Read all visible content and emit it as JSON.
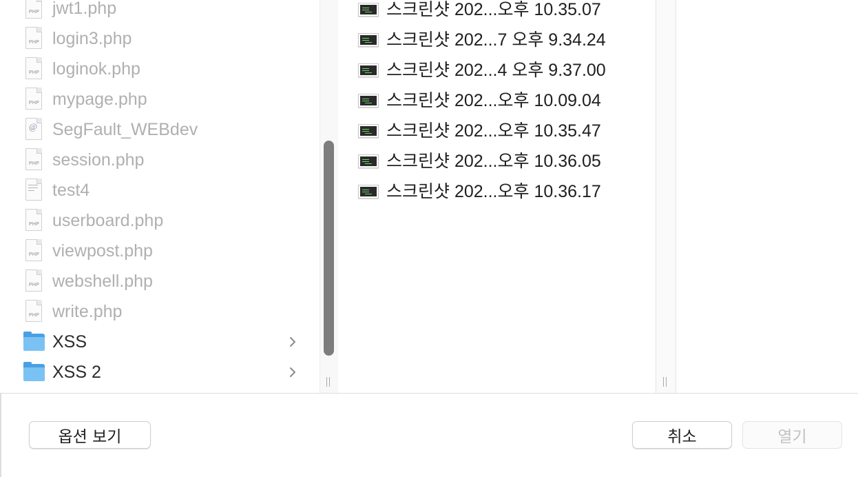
{
  "files_column": [
    {
      "name": "jwt1.php",
      "type": "php",
      "icon": "php-file-icon"
    },
    {
      "name": "login3.php",
      "type": "php",
      "icon": "php-file-icon"
    },
    {
      "name": "loginok.php",
      "type": "php",
      "icon": "php-file-icon"
    },
    {
      "name": "mypage.php",
      "type": "php",
      "icon": "php-file-icon"
    },
    {
      "name": "SegFault_WEBdev",
      "type": "alias",
      "icon": "alias-file-icon"
    },
    {
      "name": "session.php",
      "type": "php",
      "icon": "php-file-icon"
    },
    {
      "name": "test4",
      "type": "text",
      "icon": "text-file-icon"
    },
    {
      "name": "userboard.php",
      "type": "php",
      "icon": "php-file-icon"
    },
    {
      "name": "viewpost.php",
      "type": "php",
      "icon": "php-file-icon"
    },
    {
      "name": "webshell.php",
      "type": "php",
      "icon": "php-file-icon"
    },
    {
      "name": "write.php",
      "type": "php",
      "icon": "php-file-icon"
    },
    {
      "name": "XSS",
      "type": "folder",
      "icon": "folder-icon"
    },
    {
      "name": "XSS 2",
      "type": "folder",
      "icon": "folder-icon"
    }
  ],
  "screenshots_column": [
    {
      "name": "스크린샷 202...오후 10.35.07",
      "icon": "screenshot-thumbnail-icon"
    },
    {
      "name": "스크린샷 202...7 오후 9.34.24",
      "icon": "screenshot-thumbnail-icon"
    },
    {
      "name": "스크린샷 202...4 오후 9.37.00",
      "icon": "screenshot-thumbnail-icon"
    },
    {
      "name": "스크린샷 202...오후 10.09.04",
      "icon": "screenshot-thumbnail-icon"
    },
    {
      "name": "스크린샷 202...오후 10.35.47",
      "icon": "screenshot-thumbnail-icon"
    },
    {
      "name": "스크린샷 202...오후 10.36.05",
      "icon": "screenshot-thumbnail-icon"
    },
    {
      "name": "스크린샷 202...오후 10.36.17",
      "icon": "screenshot-thumbnail-icon"
    }
  ],
  "footer": {
    "options_label": "옵션 보기",
    "cancel_label": "취소",
    "open_label": "열기"
  },
  "colors": {
    "folder_blue": "#4aa0e3",
    "disabled_text": "#b0b0b0",
    "scroll_thumb": "#7d7d7d"
  }
}
